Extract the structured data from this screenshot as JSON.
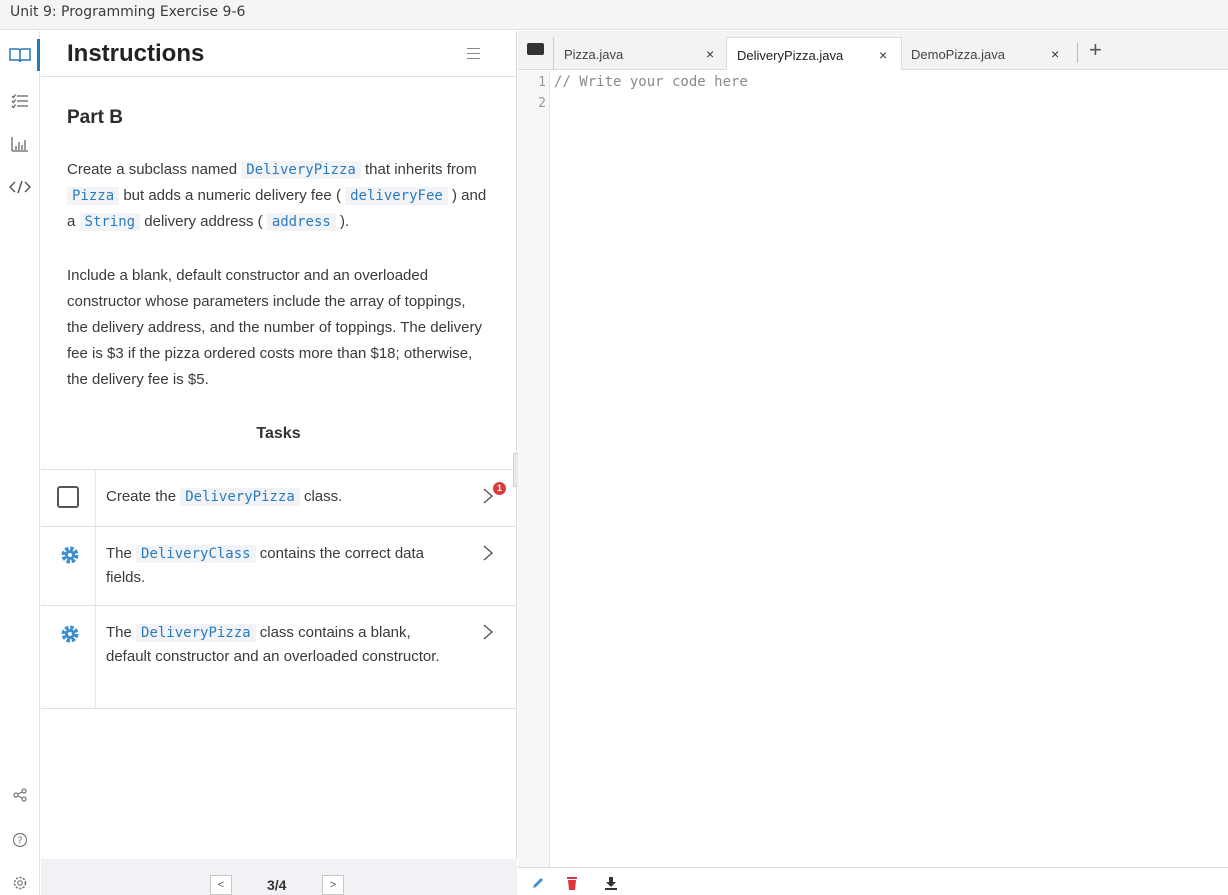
{
  "window": {
    "title": "Unit 9: Programming Exercise 9-6"
  },
  "panel": {
    "title": "Instructions",
    "part": "Part B",
    "para1": [
      {
        "t": "Create a subclass named "
      },
      {
        "c": "DeliveryPizza"
      },
      {
        "t": " that inherits from "
      },
      {
        "c": "Pizza"
      },
      {
        "t": " but adds a numeric delivery fee ( "
      },
      {
        "c": "deliveryFee"
      },
      {
        "t": " ) and a "
      },
      {
        "c": "String"
      },
      {
        "t": " delivery address ( "
      },
      {
        "c": "address"
      },
      {
        "t": " )."
      }
    ],
    "para2": "Include a blank, default constructor and an overloaded constructor whose parameters include the array of toppings, the delivery address, and the number of toppings. The delivery fee is $3 if the pizza ordered costs more than $18; otherwise, the delivery fee is $5.",
    "tasks_title": "Tasks",
    "tasks": [
      {
        "parts": [
          {
            "t": "Create the "
          },
          {
            "c": "DeliveryPizza"
          },
          {
            "t": " class."
          }
        ],
        "icon": "checkbox-icon",
        "badge": "1"
      },
      {
        "parts": [
          {
            "t": "The "
          },
          {
            "c": "DeliveryClass"
          },
          {
            "t": " contains the correct data fields."
          }
        ],
        "icon": "gear-icon"
      },
      {
        "parts": [
          {
            "t": "The "
          },
          {
            "c": "DeliveryPizza"
          },
          {
            "t": " class contains a blank, default constructor and an overloaded constructor."
          }
        ],
        "icon": "gear-icon"
      }
    ],
    "pager": {
      "prev": "<",
      "next": ">",
      "position": "3/4"
    }
  },
  "editor": {
    "tabs": [
      {
        "label": "Pizza.java",
        "close": "×",
        "active": false
      },
      {
        "label": "DeliveryPizza.java",
        "close": "×",
        "active": true
      },
      {
        "label": "DemoPizza.java",
        "close": "×",
        "active": false
      }
    ],
    "add_tab": "+",
    "line_numbers": [
      "1",
      "2"
    ],
    "code_lines": [
      "// Write your code here",
      ""
    ]
  },
  "colors": {
    "accent": "#2a7ab8",
    "code_text": "#2b7bbf",
    "badge": "#d93a3a",
    "gear": "#3e8fd0",
    "trash": "#e0343b"
  },
  "icons": [
    "book-icon",
    "list-icon",
    "chart-icon",
    "code-icon",
    "share-icon",
    "help-icon",
    "settings-icon",
    "folder-icon",
    "pencil-icon",
    "trash-icon",
    "download-icon"
  ]
}
